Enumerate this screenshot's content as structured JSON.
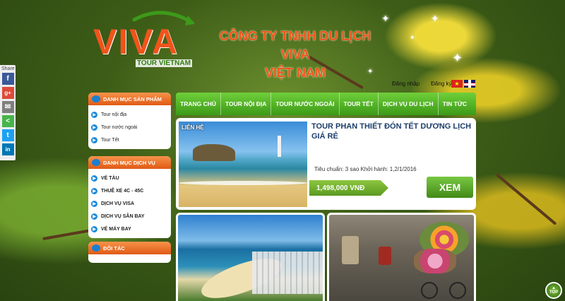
{
  "share": {
    "label": "Share",
    "buttons": [
      {
        "name": "facebook",
        "glyph": "f",
        "color": "#3b5998"
      },
      {
        "name": "google-plus",
        "glyph": "g+",
        "color": "#dd4b39"
      },
      {
        "name": "email",
        "glyph": "✉",
        "color": "#7f7f7f"
      },
      {
        "name": "sharethis",
        "glyph": "<",
        "color": "#46b54a"
      },
      {
        "name": "twitter",
        "glyph": "t",
        "color": "#1da1f2"
      },
      {
        "name": "linkedin",
        "glyph": "in",
        "color": "#0077b5"
      }
    ]
  },
  "logo": {
    "word": "VIVA",
    "sub": "TOUR VIETNAM"
  },
  "company": {
    "line1": "CÔNG TY TNHH DU LỊCH VIVA",
    "line2": "VIỆT NAM"
  },
  "top_links": {
    "login": "Đăng nhập",
    "register": "Đăng ký"
  },
  "colors": {
    "accent": "#f0541b",
    "nav_green": "#4fae22",
    "price_green": "#6aa82b",
    "sidebar_head": "#ee7630"
  },
  "nav": [
    "TRANG CHỦ",
    "TOUR NỘI ĐỊA",
    "TOUR NƯỚC NGOÀI",
    "TOUR TẾT",
    "DỊCH VỤ DU LỊCH",
    "TIN TỨC"
  ],
  "sidebar": {
    "products": {
      "title": "DANH MỤC SẢN PHẨM",
      "items": [
        "Tour nội địa",
        "Tour nước ngoài",
        "Tour Tết"
      ]
    },
    "services": {
      "title": "DANH MỤC DỊCH VỤ",
      "items": [
        "VÉ TÀU",
        "THUÊ XE 4C - 45C",
        " DỊCH VỤ VISA",
        "DỊCH VỤ SÂN BAY",
        "VÉ MÁY BAY"
      ]
    },
    "partners": {
      "title": "ĐỐI TÁC"
    }
  },
  "tour": {
    "tag": "LIÊN HỆ",
    "title": "TOUR PHAN THIẾT ĐÓN TẾT DƯƠNG LỊCH GIÁ RẺ",
    "meta": "Tiêu chuẩn: 3 sao Khởi hành: 1,2/1/2016",
    "price": "1,498,000 VNĐ",
    "button": "XEM"
  },
  "top_button": {
    "line1": "TOP"
  }
}
